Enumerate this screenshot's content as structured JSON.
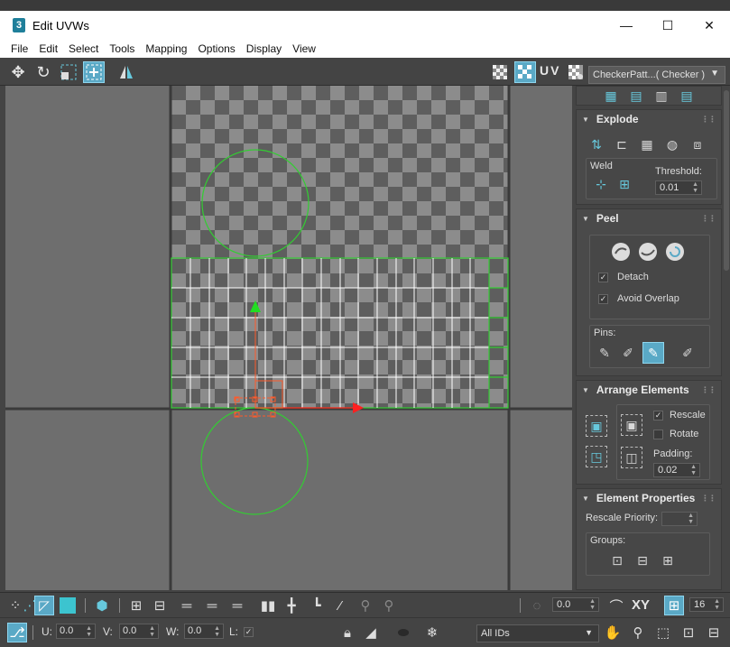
{
  "window": {
    "app_icon": "3",
    "title": "Edit UVWs",
    "controls": {
      "minimize": "—",
      "maximize": "☐",
      "close": "✕"
    }
  },
  "menu": [
    "File",
    "Edit",
    "Select",
    "Tools",
    "Mapping",
    "Options",
    "Display",
    "View"
  ],
  "toolbar": {
    "uv_label": "UV",
    "checker_select": "CheckerPatt...( Checker )"
  },
  "panel": {
    "explode": {
      "title": "Explode",
      "weld_label": "Weld",
      "threshold_label": "Threshold:",
      "threshold_value": "0.01"
    },
    "peel": {
      "title": "Peel",
      "detach_label": "Detach",
      "detach_checked": true,
      "avoid_overlap_label": "Avoid Overlap",
      "avoid_overlap_checked": true,
      "pins_label": "Pins:"
    },
    "arrange": {
      "title": "Arrange Elements",
      "rescale_label": "Rescale",
      "rescale_checked": true,
      "rotate_label": "Rotate",
      "rotate_checked": false,
      "padding_label": "Padding:",
      "padding_value": "0.02"
    },
    "element_props": {
      "title": "Element Properties",
      "rescale_priority_label": "Rescale Priority:",
      "rescale_priority_value": "",
      "groups_label": "Groups:"
    }
  },
  "bottom_toolbar": {
    "angle_value": "0.0",
    "xy_label": "XY",
    "grid_value": "16"
  },
  "coords": {
    "u_label": "U:",
    "u_value": "0.0",
    "v_label": "V:",
    "v_value": "0.0",
    "w_label": "W:",
    "w_value": "0.0",
    "l_label": "L:"
  },
  "ids_select": "All IDs",
  "colors": {
    "accent": "#5aa9c6",
    "uv_edges_selected": "#33cc33",
    "gizmo_x": "#ff2020",
    "gizmo_y": "#22dd22",
    "gizmo_selection": "#ff5a2a"
  }
}
